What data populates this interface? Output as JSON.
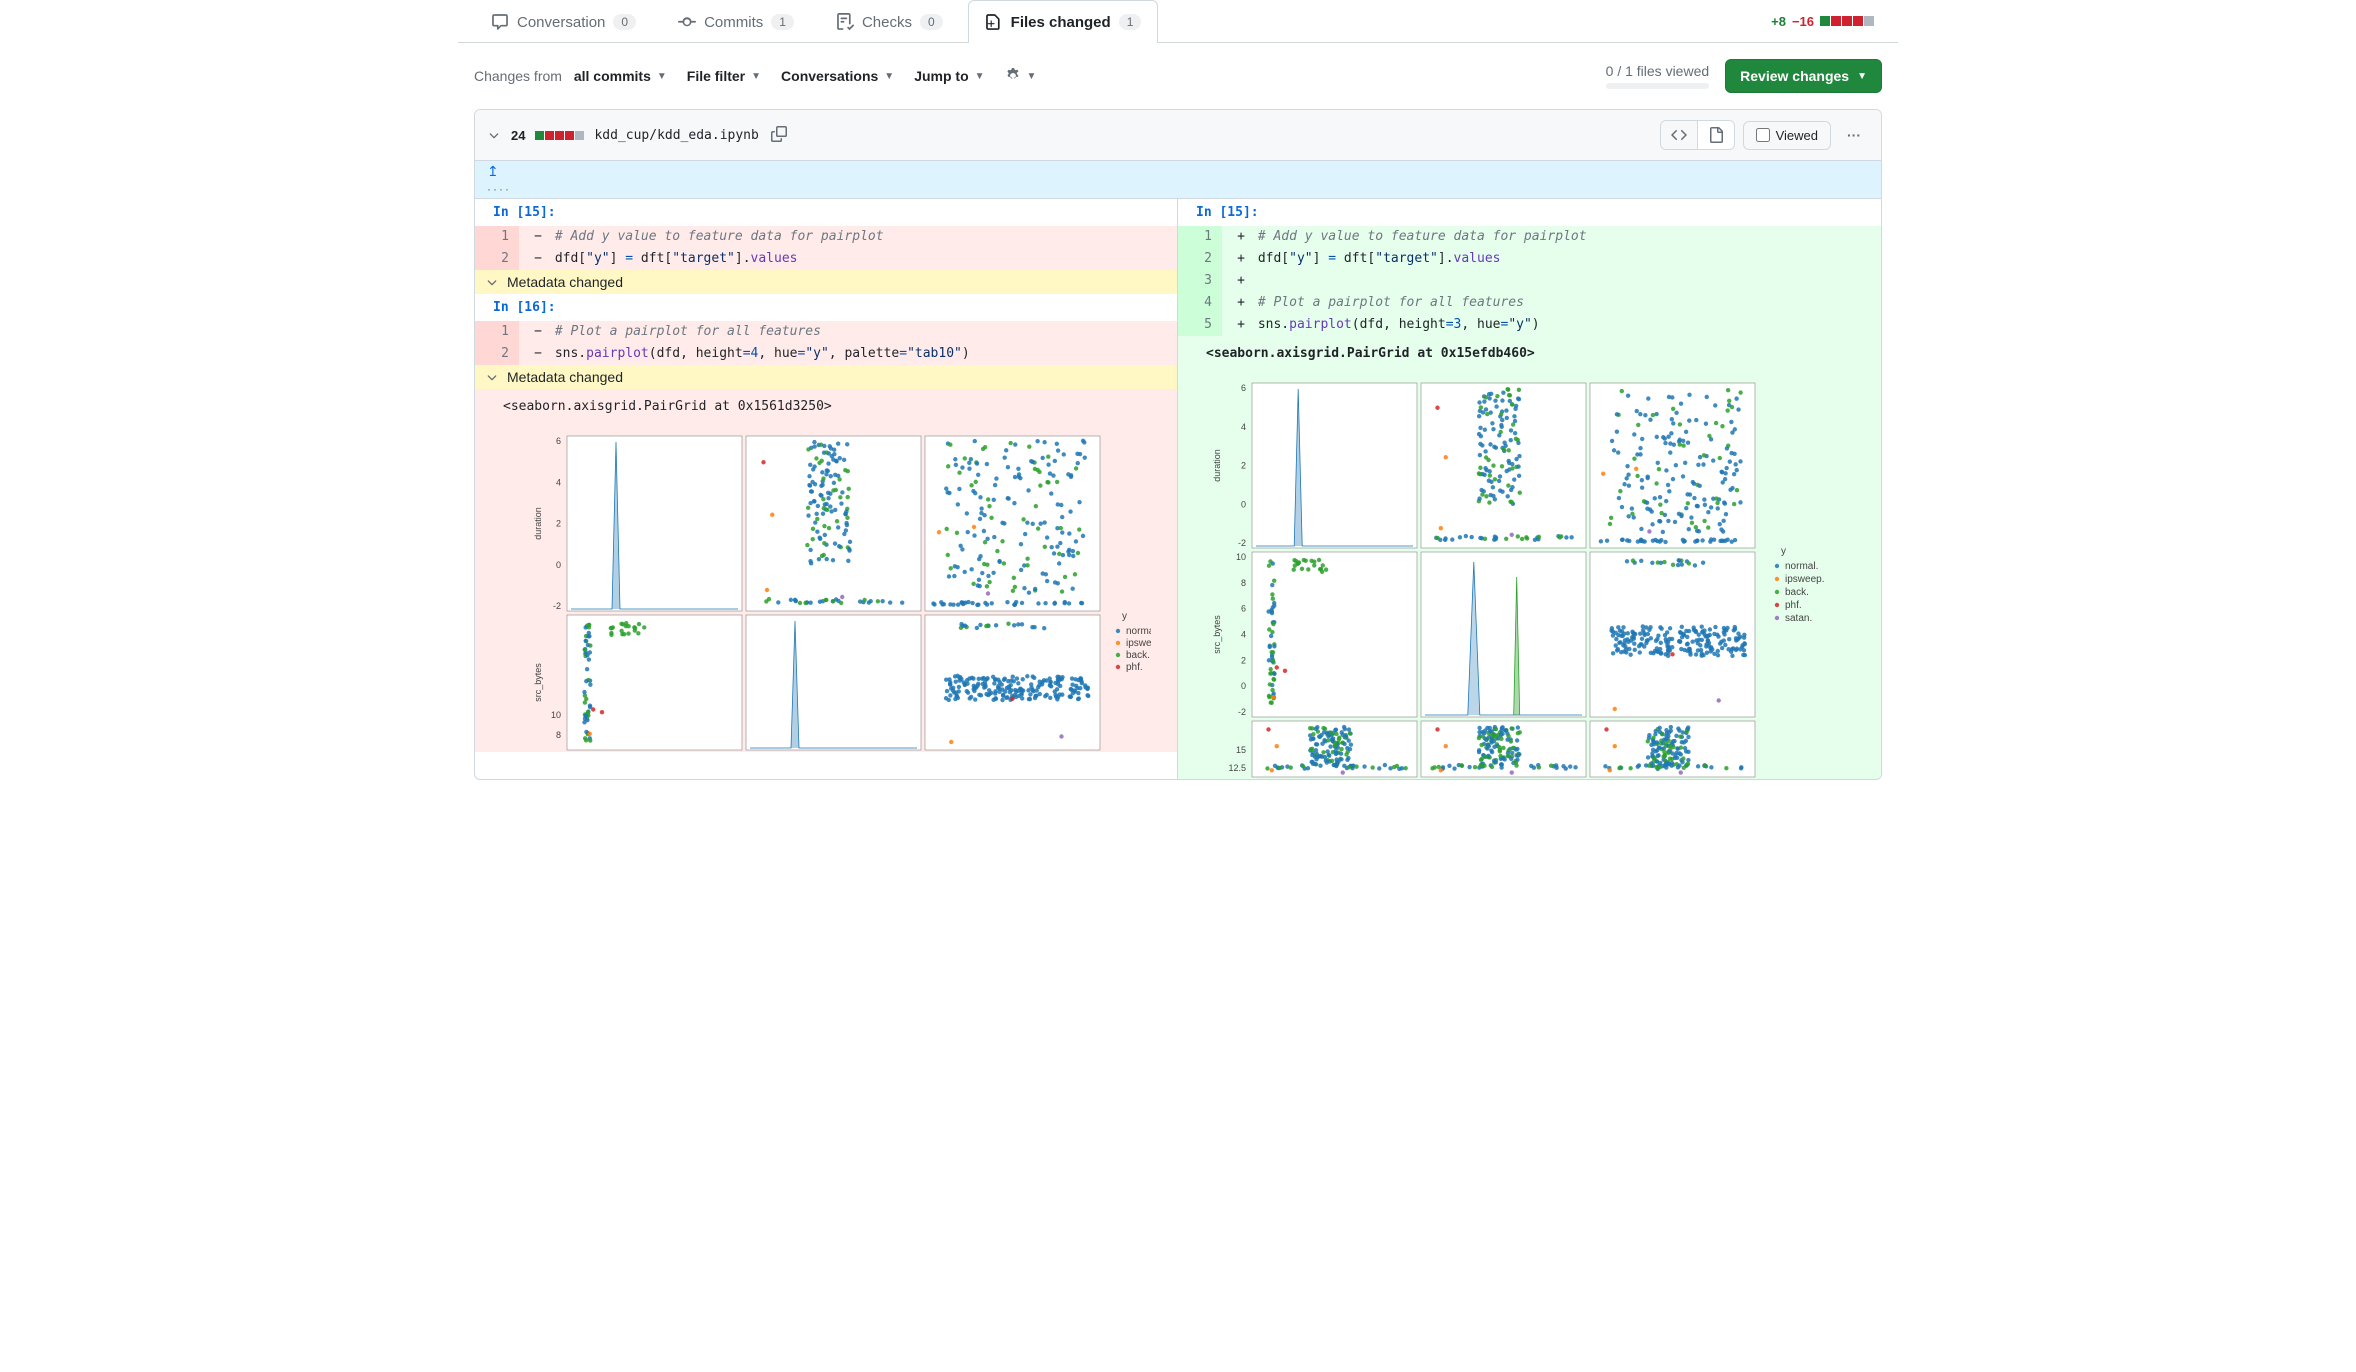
{
  "tabs": {
    "conversation": {
      "label": "Conversation",
      "count": "0"
    },
    "commits": {
      "label": "Commits",
      "count": "1"
    },
    "checks": {
      "label": "Checks",
      "count": "0"
    },
    "files": {
      "label": "Files changed",
      "count": "1"
    }
  },
  "diffstat": {
    "additions": "+8",
    "deletions": "−16"
  },
  "toolbar": {
    "changes_from_label": "Changes from",
    "changes_from_value": "all commits",
    "file_filter": "File filter",
    "conversations": "Conversations",
    "jump_to": "Jump to",
    "files_viewed": "0 / 1 files viewed",
    "review_changes": "Review changes"
  },
  "file": {
    "stat": "24",
    "path": "kdd_cup/kdd_eda.ipynb",
    "viewed_label": "Viewed"
  },
  "diff": {
    "left": {
      "cell15_prompt": "In [15]:",
      "lines15": [
        {
          "num": "1",
          "marker": "−",
          "html": "<span class='tok-comment'># Add y value to feature data for pairplot</span>"
        },
        {
          "num": "2",
          "marker": "−",
          "html": "dfd[<span class='tok-string'>\"y\"</span>] <span class='tok-op'>=</span> dft[<span class='tok-string'>\"target\"</span>].<span class='tok-func'>values</span>"
        }
      ],
      "metadata_changed": "Metadata changed",
      "cell16_prompt": "In [16]:",
      "lines16": [
        {
          "num": "1",
          "marker": "−",
          "html": "<span class='tok-comment'># Plot a pairplot for all features</span>"
        },
        {
          "num": "2",
          "marker": "−",
          "html": "sns.<span class='tok-func'>pairplot</span>(dfd, height<span class='tok-op'>=</span><span class='tok-num'>4</span>, hue<span class='tok-op'>=</span><span class='tok-string'>\"y\"</span>, palette<span class='tok-op'>=</span><span class='tok-string'>\"tab10\"</span>)"
        }
      ],
      "output_text": "<seaborn.axisgrid.PairGrid at 0x1561d3250>"
    },
    "right": {
      "cell15_prompt": "In [15]:",
      "lines15": [
        {
          "num": "1",
          "marker": "+",
          "html": "<span class='tok-comment'># Add y value to feature data for pairplot</span>"
        },
        {
          "num": "2",
          "marker": "+",
          "html": "dfd[<span class='tok-string'>\"y\"</span>] <span class='tok-op'>=</span> dft[<span class='tok-string'>\"target\"</span>].<span class='tok-func'>values</span>"
        },
        {
          "num": "3",
          "marker": "+",
          "html": ""
        },
        {
          "num": "4",
          "marker": "+",
          "html": "<span class='tok-comment'># Plot a pairplot for all features</span>"
        },
        {
          "num": "5",
          "marker": "+",
          "html": "sns.<span class='tok-func'>pairplot</span>(dfd, height<span class='tok-op'>=</span><span class='tok-num'>3</span>, hue<span class='tok-op'>=</span><span class='tok-string'>\"y\"</span>)"
        }
      ],
      "output_text": "<seaborn.axisgrid.PairGrid at 0x15efdb460>"
    }
  },
  "chart_data": {
    "legend_title": "y",
    "legend": [
      "normal.",
      "ipsweep.",
      "back.",
      "phf.",
      "satan."
    ],
    "colors": {
      "normal.": "#1f77b4",
      "ipsweep.": "#ff7f0e",
      "back.": "#2ca02c",
      "phf.": "#d62728",
      "satan.": "#9467bd"
    },
    "row_labels": [
      "duration",
      "src_bytes"
    ],
    "row1_yticks": [
      -2,
      0,
      2,
      4,
      6
    ],
    "row2_yticks_left": [
      8,
      10
    ],
    "row2_yticks_right": [
      -2,
      0,
      2,
      4,
      6,
      8,
      10
    ],
    "row3_yticks_right": [
      12.5,
      15.0
    ]
  }
}
